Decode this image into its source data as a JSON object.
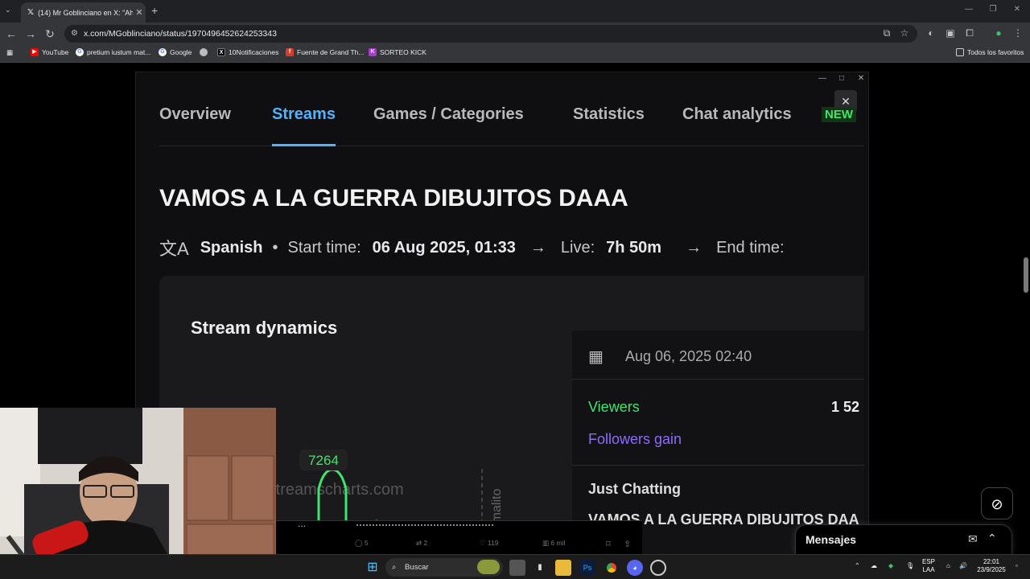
{
  "browser": {
    "tab_title": "(14) Mr Goblinciano en X: \"Ahí",
    "url": "x.com/MGoblinciano/status/1970496452624253343",
    "bookmarks": [
      {
        "label": "YouTube",
        "color": "#ff0000"
      },
      {
        "label": "pretium iustum mat...",
        "color": "#ffffff"
      },
      {
        "label": "Google",
        "color": "#ffffff"
      },
      {
        "label": "",
        "color": "#bbbbbb"
      },
      {
        "label": "10Notificaciones",
        "color": "#000000"
      },
      {
        "label": "Fuente de Grand Th...",
        "color": "#d43b2a"
      },
      {
        "label": "SORTEO KICK",
        "color": "#a83ad1"
      }
    ],
    "all_favorites": "Todos los favoritos"
  },
  "streamscharts": {
    "tabs": [
      "Overview",
      "Streams",
      "Games / Categories",
      "Statistics",
      "Chat analytics"
    ],
    "active_tab": "Streams",
    "new_badge": "NEW",
    "stream_title": "VAMOS A LA GUERRA DIBUJITOS DAAA",
    "language": "Spanish",
    "start_label": "Start time:",
    "start_value": "06 Aug 2025, 01:33",
    "live_label": "Live:",
    "live_value": "7h 50m",
    "end_label": "End time:",
    "dynamics_title": "Stream dynamics",
    "watermark": "by streamscharts.com",
    "annotation": "estoy malito",
    "peak_label": "7264",
    "tooltip": {
      "date": "Aug 06, 2025 02:40",
      "viewers_label": "Viewers",
      "viewers_value": "1 52",
      "followers_label": "Followers gain",
      "category": "Just Chatting",
      "title": "VAMOS A LA GUERRA DIBUJITOS DAA"
    },
    "colors": {
      "active_tab": "#4fb3ff",
      "series": "#3ee66b",
      "followers": "#8f6bff"
    }
  },
  "x_actions": {
    "replies": "5",
    "reposts": "2",
    "likes": "119",
    "views": "6 mil",
    "more": "..."
  },
  "messages": {
    "label": "Mensajes"
  },
  "taskbar": {
    "search": "Buscar",
    "lang": "ESP",
    "lang2": "LAA",
    "time": "22:01",
    "date": "23/9/2025"
  },
  "chart_data": {
    "type": "line",
    "series": [
      {
        "name": "Viewers",
        "peak": 7264
      }
    ],
    "annotations": [
      "estoy malito"
    ],
    "peak_label": 7264
  }
}
